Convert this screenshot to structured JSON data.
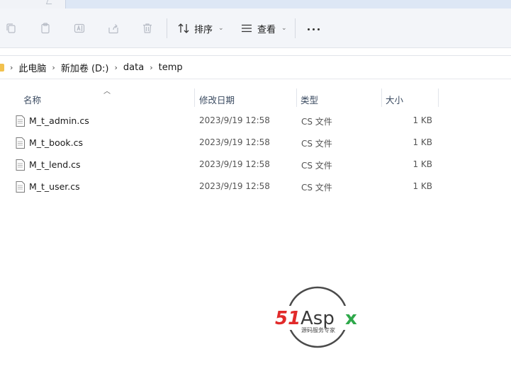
{
  "toolbar": {
    "sort_label": "排序",
    "view_label": "查看",
    "icons": [
      "copy-icon",
      "paste-icon",
      "rename-icon",
      "share-icon",
      "delete-icon",
      "sort-icon",
      "view-icon",
      "more-icon"
    ]
  },
  "address": {
    "crumbs": [
      "此电脑",
      "新加卷 (D:)",
      "data",
      "temp"
    ]
  },
  "columns": {
    "name": "名称",
    "modified": "修改日期",
    "type": "类型",
    "size": "大小"
  },
  "files": [
    {
      "name": "M_t_admin.cs",
      "modified": "2023/9/19 12:58",
      "type": "CS 文件",
      "size": "1 KB"
    },
    {
      "name": "M_t_book.cs",
      "modified": "2023/9/19 12:58",
      "type": "CS 文件",
      "size": "1 KB"
    },
    {
      "name": "M_t_lend.cs",
      "modified": "2023/9/19 12:58",
      "type": "CS 文件",
      "size": "1 KB"
    },
    {
      "name": "M_t_user.cs",
      "modified": "2023/9/19 12:58",
      "type": "CS 文件",
      "size": "1 KB"
    }
  ],
  "watermark": {
    "brand": "51Aspx",
    "tagline": "源码服务专家"
  },
  "colors": {
    "accent_red": "#e12a2a",
    "accent_green": "#2ea84a",
    "folder_yellow": "#f2c14e"
  }
}
